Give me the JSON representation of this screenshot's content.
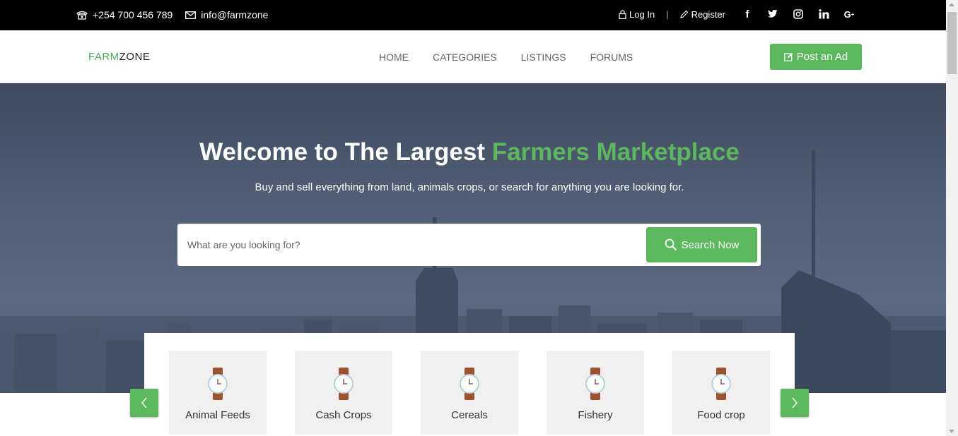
{
  "topbar": {
    "phone": "+254 700 456 789",
    "email": "info@farmzone",
    "login": "Log In",
    "separator": "|",
    "register": "Register",
    "social_icons": [
      "facebook-icon",
      "twitter-icon",
      "instagram-icon",
      "linkedin-icon",
      "google-plus-icon"
    ]
  },
  "navbar": {
    "logo_part1": "FARM",
    "logo_part2": "ZONE",
    "menu": [
      "HOME",
      "CATEGORIES",
      "LISTINGS",
      "FORUMS"
    ],
    "post_ad": "Post an Ad"
  },
  "hero": {
    "title_white": "Welcome to The Largest ",
    "title_green": "Farmers Marketplace",
    "subtitle": "Buy and sell everything from land, animals crops, or search for anything you are looking for."
  },
  "search": {
    "placeholder": "What are you looking for?",
    "button": "Search Now"
  },
  "categories": [
    {
      "label": "Animal Feeds",
      "icon": "watch-icon"
    },
    {
      "label": "Cash Crops",
      "icon": "watch-icon"
    },
    {
      "label": "Cereals",
      "icon": "watch-icon"
    },
    {
      "label": "Fishery",
      "icon": "watch-icon"
    },
    {
      "label": "Food crop",
      "icon": "watch-icon"
    }
  ],
  "colors": {
    "accent": "#5cb85c",
    "topbar": "#000000",
    "hero_overlay": "#4d5a70"
  }
}
